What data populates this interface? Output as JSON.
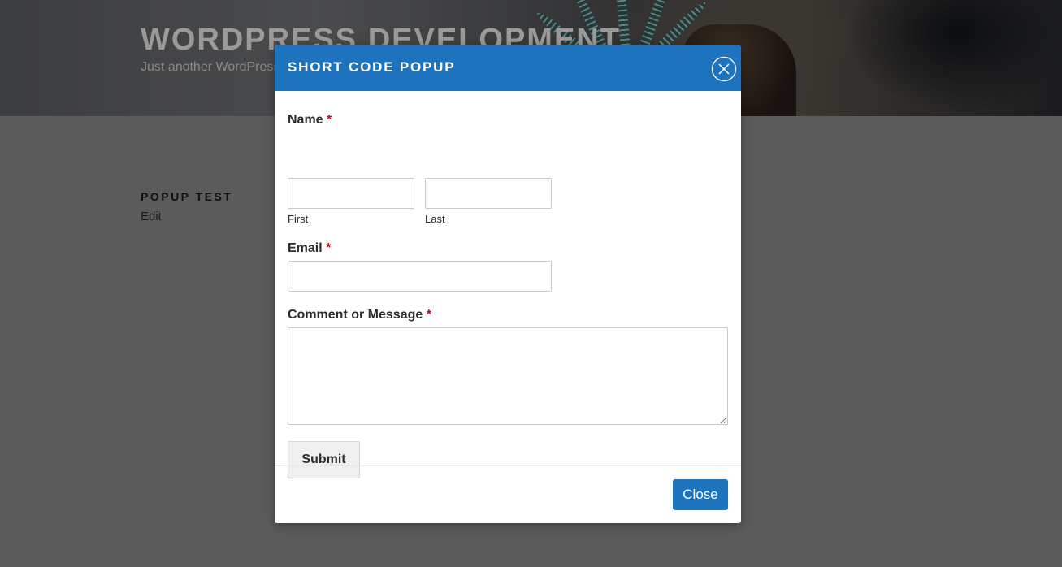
{
  "site": {
    "title": "WORDPRESS DEVELOPMENT",
    "description": "Just another WordPress site"
  },
  "page": {
    "entry_title": "POPUP TEST",
    "edit_link": "Edit"
  },
  "modal": {
    "title": "SHORT CODE POPUP",
    "close_icon": "close-circle-icon",
    "form": {
      "name_label": "Name",
      "required_mark": "*",
      "first_sublabel": "First",
      "last_sublabel": "Last",
      "first_value": "",
      "last_value": "",
      "email_label": "Email",
      "email_value": "",
      "message_label": "Comment or Message",
      "message_value": "",
      "submit_label": "Submit"
    },
    "footer": {
      "close_label": "Close"
    }
  },
  "colors": {
    "accent": "#1e73be",
    "required": "#d8000c",
    "overlay": "#5b5b5b"
  }
}
